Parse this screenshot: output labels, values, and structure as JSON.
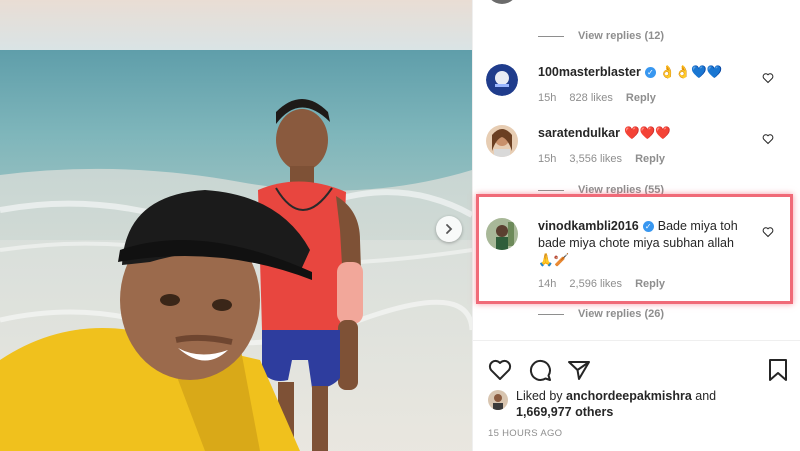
{
  "post": {
    "view_replies_top": "View replies (12)",
    "comments": [
      {
        "username": "100masterblaster",
        "text": "👌👌💙💙",
        "time": "15h",
        "likes": "828 likes",
        "reply_label": "Reply"
      },
      {
        "username": "saratendulkar",
        "text": "❤️❤️❤️",
        "time": "15h",
        "likes": "3,556 likes",
        "reply_label": "Reply",
        "view_replies": "View replies (55)"
      },
      {
        "username": "vinodkambli2016",
        "text": "Bade miya toh bade miya chote miya subhan allah🙏🏏",
        "time": "14h",
        "likes": "2,596 likes",
        "reply_label": "Reply",
        "view_replies": "View replies (26)"
      }
    ],
    "liked_by_prefix": "Liked by",
    "liked_by_user": "anchordeepakmishra",
    "liked_by_and": "and",
    "liked_by_others": "1,669,977 others",
    "time_ago": "15 HOURS AGO"
  },
  "icons": {
    "verified": "verified-badge-icon",
    "heart": "heart-icon",
    "comment": "comment-icon",
    "share": "share-icon",
    "save": "bookmark-icon",
    "next": "chevron-right-icon"
  },
  "colors": {
    "verified": "#3897f0",
    "highlight": "#f06a78",
    "heart_red": "#ed4956",
    "muted": "#8e8e8e"
  }
}
